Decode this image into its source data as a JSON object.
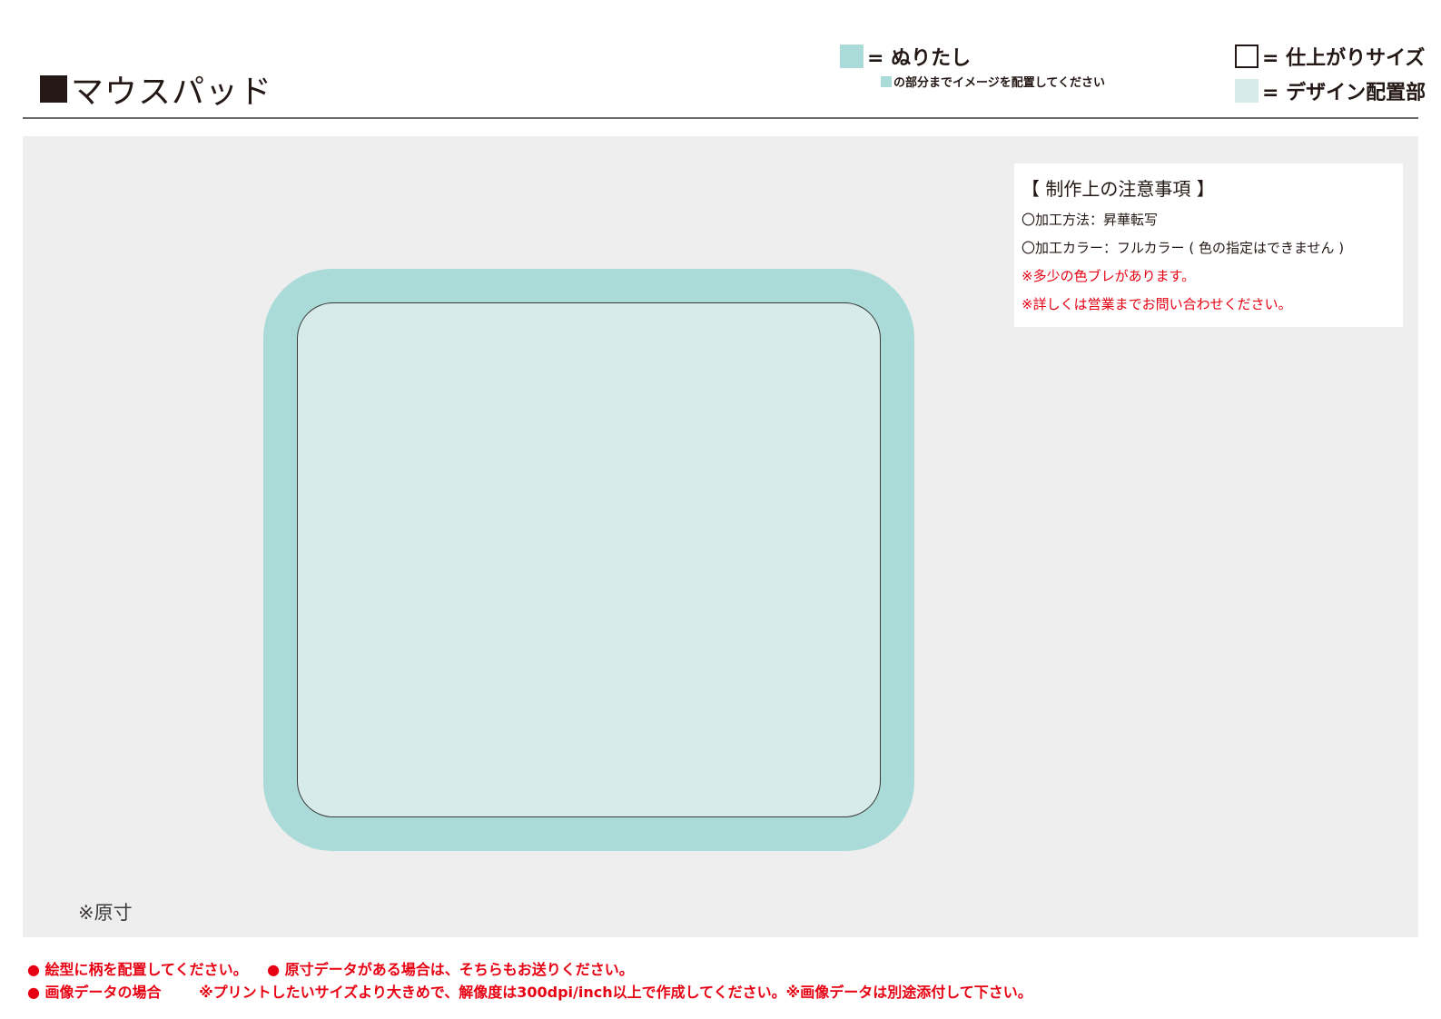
{
  "title": "マウスパッド",
  "legend": {
    "bleed_label": "= ぬりたし",
    "bleed_note": "の部分までイメージを配置してください",
    "trim_label": "= 仕上がりサイズ",
    "design_label": "= デザイン配置部",
    "colors": {
      "bleed": "#aadbd9",
      "design": "#d7ecea",
      "trim_border": "#231815"
    }
  },
  "notes": {
    "title": "【 制作上の注意事項 】",
    "lines": [
      "〇加工方法：昇華転写",
      "〇加工カラー：フルカラー ( 色の指定はできません )"
    ],
    "warnings": [
      "※多少の色ブレがあります。",
      "※詳しくは営業までお問い合わせください。"
    ],
    "warning_color": "#e60012"
  },
  "actual_size": "※原寸",
  "footer": {
    "line1": [
      "● 絵型に柄を配置してください。",
      "● 原寸データがある場合は、そちらもお送りください。"
    ],
    "line2": [
      "● 画像データの場合",
      "※プリントしたいサイズより大きめで、解像度は300dpi/inch以上で作成してください。※画像データは別途添付して下さい。"
    ]
  }
}
